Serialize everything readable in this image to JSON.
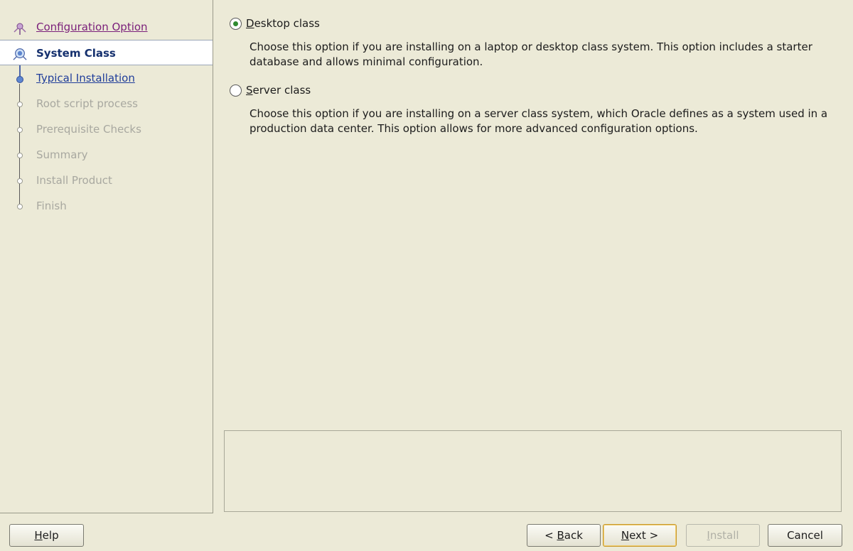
{
  "steps": [
    {
      "label": "Configuration Option",
      "state": "visited"
    },
    {
      "label": "System Class",
      "state": "active"
    },
    {
      "label": "Typical Installation",
      "state": "link"
    },
    {
      "label": "Root script process",
      "state": "disabled"
    },
    {
      "label": "Prerequisite Checks",
      "state": "disabled"
    },
    {
      "label": "Summary",
      "state": "disabled"
    },
    {
      "label": "Install Product",
      "state": "disabled"
    },
    {
      "label": "Finish",
      "state": "disabled"
    }
  ],
  "options": {
    "desktop": {
      "mnemonic": "D",
      "label_rest": "esktop class",
      "selected": true,
      "description": "Choose this option if you are installing on a laptop or desktop class system. This option includes a starter database and allows minimal configuration."
    },
    "server": {
      "mnemonic": "S",
      "label_rest": "erver class",
      "selected": false,
      "description": "Choose this option if you are installing on a server class system, which Oracle defines as a system used in a production data center. This option allows for more advanced configuration options."
    }
  },
  "buttons": {
    "help": {
      "mnemonic": "H",
      "rest": "elp"
    },
    "back": {
      "pre": "< ",
      "mnemonic": "B",
      "rest": "ack"
    },
    "next": {
      "mnemonic": "N",
      "rest": "ext >"
    },
    "install": {
      "mnemonic": "I",
      "rest": "nstall"
    },
    "cancel": {
      "label": "Cancel"
    }
  },
  "colors": {
    "background": "#ecead7",
    "active_step_text": "#15306e",
    "visited_link": "#7a1f7a",
    "link": "#1f3d9a",
    "disabled_text": "#a8a8a0",
    "radio_selected": "#2f8a2f"
  }
}
